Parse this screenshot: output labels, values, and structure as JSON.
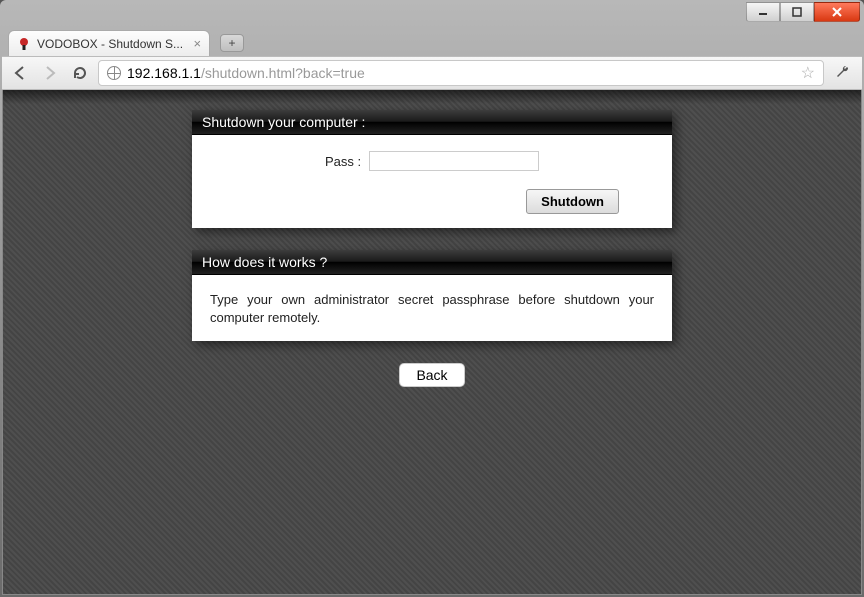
{
  "browser": {
    "tab_title": "VODOBOX - Shutdown S...",
    "url_host": "192.168.1.1",
    "url_path": "/shutdown.html?back=true"
  },
  "page": {
    "panels": {
      "shutdown": {
        "title": "Shutdown your computer :",
        "pass_label": "Pass :",
        "pass_value": "",
        "submit_label": "Shutdown"
      },
      "help": {
        "title": "How does it works ?",
        "body": "Type your own administrator secret passphrase before shutdown your computer remotely."
      }
    },
    "back_label": "Back"
  }
}
